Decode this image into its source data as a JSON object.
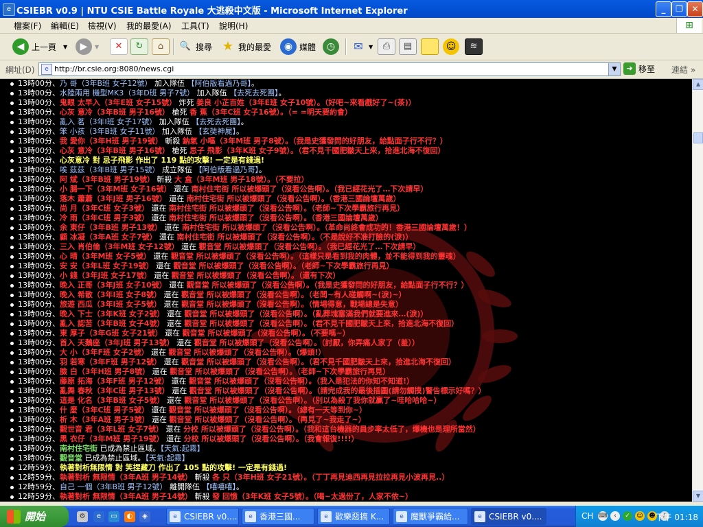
{
  "window": {
    "title": "CSIEBR v0.9 | NTU CSIE Battle Royale 大逃殺中文版 - Microsoft Internet Explorer",
    "minimize": "_",
    "restore": "❐",
    "close": "✕"
  },
  "menu": [
    "檔案(F)",
    "編輯(E)",
    "檢視(V)",
    "我的最愛(A)",
    "工具(T)",
    "說明(H)"
  ],
  "toolbar": {
    "back_label": "上一頁",
    "search_label": "搜尋",
    "favorites_label": "我的最愛",
    "media_label": "媒體"
  },
  "address": {
    "label": "網址(D)",
    "url": "http://br.csie.org:8080/news.cgi",
    "go_label": "移至",
    "links_label": "連結",
    "more": "»"
  },
  "news": [
    [
      {
        "t": "13時00分、",
        "c": "t"
      },
      {
        "t": "乃 哥（3年B班 女子12號）",
        "c": "b"
      },
      {
        "t": " 加入隊伍 ",
        "c": "w"
      },
      {
        "t": "【阿伯版看過乃哥】",
        "c": "b"
      },
      {
        "t": "。",
        "c": "w"
      }
    ],
    [
      {
        "t": "13時00分、",
        "c": "t"
      },
      {
        "t": "水陸兩用 機型MK3（3年D班 男子7號）",
        "c": "b"
      },
      {
        "t": " 加入隊伍 ",
        "c": "w"
      },
      {
        "t": "【去死去死團】",
        "c": "b"
      },
      {
        "t": "。",
        "c": "w"
      }
    ],
    [
      {
        "t": "13時00分、",
        "c": "t"
      },
      {
        "t": "鬼眼 太早入（3年E班 女子15號）",
        "c": "r"
      },
      {
        "t": " 炸死 ",
        "c": "w"
      },
      {
        "t": "姜良 小芷百姓（3年E班 女子10號）",
        "c": "r"
      },
      {
        "t": "。（好吧~來看戲好了~(茶)）",
        "c": "r"
      }
    ],
    [
      {
        "t": "13時00分、",
        "c": "t"
      },
      {
        "t": "心灰 意冷（3年B班 男子16號）",
        "c": "r"
      },
      {
        "t": " 槍死 ",
        "c": "w"
      },
      {
        "t": "香 蕉（3年C班 女子16號）",
        "c": "r"
      },
      {
        "t": "。（= =明天要約會）",
        "c": "r"
      }
    ],
    [
      {
        "t": "13時00分、",
        "c": "t"
      },
      {
        "t": "亂入 茗（3年I班 女子17號）",
        "c": "b"
      },
      {
        "t": " 加入隊伍 ",
        "c": "w"
      },
      {
        "t": "【去死去死團】",
        "c": "b"
      },
      {
        "t": "。",
        "c": "w"
      }
    ],
    [
      {
        "t": "13時00分、",
        "c": "t"
      },
      {
        "t": "笨 小孩（3年B班 女子11號）",
        "c": "b"
      },
      {
        "t": " 加入隊伍 ",
        "c": "w"
      },
      {
        "t": "【玄奘神屍】",
        "c": "b"
      },
      {
        "t": "。",
        "c": "w"
      }
    ],
    [
      {
        "t": "13時00分、",
        "c": "t"
      },
      {
        "t": "我 愛你（3年H班 男子19號）",
        "c": "r"
      },
      {
        "t": " 斬殺 ",
        "c": "w"
      },
      {
        "t": "鈉氣 小嘔（3年M班 男子8號）",
        "c": "r"
      },
      {
        "t": "。（我是史獲發問的好朋友，給點面子行不行？）",
        "c": "r"
      }
    ],
    [
      {
        "t": "13時00分、",
        "c": "t"
      },
      {
        "t": "心灰 意冷（3年B班 男子16號）",
        "c": "r"
      },
      {
        "t": " 槍死 ",
        "c": "w"
      },
      {
        "t": "忌子 飛影（3年K班 女子9號）",
        "c": "r"
      },
      {
        "t": "。（君不見千國肥皺天上來，拾進北海不復回）",
        "c": "r"
      }
    ],
    [
      {
        "t": "13時00分、",
        "c": "t"
      },
      {
        "t": "心灰意冷 對 忌子飛影 作出了 ",
        "c": "y"
      },
      {
        "t": "119",
        "c": "y"
      },
      {
        "t": " 點的攻擊! 一定是有錢過!",
        "c": "y"
      }
    ],
    [
      {
        "t": "13時00分、",
        "c": "t"
      },
      {
        "t": "唉 茲茲（3年B班 男子15號）",
        "c": "b"
      },
      {
        "t": " 成立隊伍 ",
        "c": "w"
      },
      {
        "t": "【阿伯版看過乃哥】",
        "c": "b"
      },
      {
        "t": "。",
        "c": "w"
      }
    ],
    [
      {
        "t": "13時00分、",
        "c": "t"
      },
      {
        "t": "阿 斌（3年B班 男子19號）",
        "c": "r"
      },
      {
        "t": " 斬殺 ",
        "c": "w"
      },
      {
        "t": "大 盒（3年M班 男子18號）",
        "c": "r"
      },
      {
        "t": "。（不要拉）",
        "c": "r"
      }
    ],
    [
      {
        "t": "13時00分、",
        "c": "t"
      },
      {
        "t": "小 腸一下（3年M班 女子16號）",
        "c": "r"
      },
      {
        "t": " 還在 ",
        "c": "w"
      },
      {
        "t": "南村住宅街",
        "c": "r"
      },
      {
        "t": " 所以被爆頭了（沒看公告啊）。（我已經花光了…下次請早）",
        "c": "r"
      }
    ],
    [
      {
        "t": "13時00分、",
        "c": "t"
      },
      {
        "t": "落木 蕭蕭（3年J班 男子16號）",
        "c": "r"
      },
      {
        "t": " 還在 ",
        "c": "w"
      },
      {
        "t": "南村住宅街",
        "c": "r"
      },
      {
        "t": " 所以被爆頭了（沒看公告啊）。（香港三國論壇萬歲）",
        "c": "r"
      }
    ],
    [
      {
        "t": "13時00分、",
        "c": "t"
      },
      {
        "t": "尚 月（3年C班 女子3號）",
        "c": "r"
      },
      {
        "t": " 還在 ",
        "c": "w"
      },
      {
        "t": "南村住宅街",
        "c": "r"
      },
      {
        "t": " 所以被爆頭了（沒看公告啊）。（老師~下次學霸旅行再見）",
        "c": "r"
      }
    ],
    [
      {
        "t": "13時00分、",
        "c": "t"
      },
      {
        "t": "冷 雨（3年C班 男子3號）",
        "c": "r"
      },
      {
        "t": " 還在 ",
        "c": "w"
      },
      {
        "t": "南村住宅街",
        "c": "r"
      },
      {
        "t": " 所以被爆頭了（沒看公告啊）。（香港三國論壇萬歲）",
        "c": "r"
      }
    ],
    [
      {
        "t": "13時00分、",
        "c": "t"
      },
      {
        "t": "余 東仔（3年B班 男子13號）",
        "c": "r"
      },
      {
        "t": " 還在 ",
        "c": "w"
      },
      {
        "t": "南村住宅街",
        "c": "r"
      },
      {
        "t": " 所以被爆頭了（沒看公告啊）。（革命尚終會成功的！香港三國論壇萬歲！）",
        "c": "r"
      }
    ],
    [
      {
        "t": "13時00分、",
        "c": "t"
      },
      {
        "t": "顧 冰凝（3年A班 女子7號）",
        "c": "r"
      },
      {
        "t": " 還在 ",
        "c": "w"
      },
      {
        "t": "南村住宅街",
        "c": "r"
      },
      {
        "t": " 所以被爆頭了（沒看公告啊）。（不是說好不准打臉的(淚)）",
        "c": "r"
      }
    ],
    [
      {
        "t": "13時00分、",
        "c": "t"
      },
      {
        "t": "三入 肖伯倫（3年M班 女子12號）",
        "c": "r"
      },
      {
        "t": " 還在 ",
        "c": "w"
      },
      {
        "t": "觀音堂",
        "c": "r"
      },
      {
        "t": " 所以被爆頭了（沒看公告啊）。（我已經花光了…下次請早）",
        "c": "r"
      }
    ],
    [
      {
        "t": "13時00分、",
        "c": "t"
      },
      {
        "t": "心 晴（3年M班 女子5號）",
        "c": "r"
      },
      {
        "t": " 還在 ",
        "c": "w"
      },
      {
        "t": "觀音堂",
        "c": "r"
      },
      {
        "t": " 所以被爆頭了（沒看公告啊）。（這樣只是看到我的肉體，並不能得到我的靈魂）",
        "c": "r"
      }
    ],
    [
      {
        "t": "13時00分、",
        "c": "t"
      },
      {
        "t": "安 安（3年L班 女子19號）",
        "c": "r"
      },
      {
        "t": " 還在 ",
        "c": "w"
      },
      {
        "t": "觀音堂",
        "c": "r"
      },
      {
        "t": " 所以被爆頭了（沒看公告啊）。（老師~下次學霸旅行再見）",
        "c": "r"
      }
    ],
    [
      {
        "t": "13時00分、",
        "c": "t"
      },
      {
        "t": "小 錢（3年J班 女子17號）",
        "c": "r"
      },
      {
        "t": " 還在 ",
        "c": "w"
      },
      {
        "t": "觀音堂",
        "c": "r"
      },
      {
        "t": " 所以被爆頭了（沒看公告啊）。（還有下次）",
        "c": "r"
      }
    ],
    [
      {
        "t": "13時00分、",
        "c": "t"
      },
      {
        "t": "晚入 正哥（3年J班 女子10號）",
        "c": "r"
      },
      {
        "t": " 還在 ",
        "c": "w"
      },
      {
        "t": "觀音堂",
        "c": "r"
      },
      {
        "t": " 所以被爆頭了（沒看公告啊）。（我是史獲發問的好朋友，給點面子行不行？）",
        "c": "r"
      }
    ],
    [
      {
        "t": "13時00分、",
        "c": "t"
      },
      {
        "t": "晚入 希散（3年I班 女子8號）",
        "c": "r"
      },
      {
        "t": " 還在 ",
        "c": "w"
      },
      {
        "t": "觀音堂",
        "c": "r"
      },
      {
        "t": " 所以被爆頭了（沒看公告啊）。（老闆~有人碰觸啊~(淚)~）",
        "c": "r"
      }
    ],
    [
      {
        "t": "13時00分、",
        "c": "t"
      },
      {
        "t": "旅遊 西瓜（3年I班 女子5號）",
        "c": "r"
      },
      {
        "t": " 還在 ",
        "c": "w"
      },
      {
        "t": "觀音堂",
        "c": "r"
      },
      {
        "t": " 所以被爆頭了（沒看公告啊）。（情場得意，戰場總是失意）",
        "c": "r"
      }
    ],
    [
      {
        "t": "13時00分、",
        "c": "t"
      },
      {
        "t": "晚入 下士（3年K班 女子2號）",
        "c": "r"
      },
      {
        "t": " 還在 ",
        "c": "w"
      },
      {
        "t": "觀音堂",
        "c": "r"
      },
      {
        "t": " 所以被爆頭了（沒看公告啊）。（亂葬塊塞滿我們就要進來…(淚)）",
        "c": "r"
      }
    ],
    [
      {
        "t": "13時00分、",
        "c": "t"
      },
      {
        "t": "亂入 認苦（3年B班 女子4號）",
        "c": "r"
      },
      {
        "t": " 還在 ",
        "c": "w"
      },
      {
        "t": "觀音堂",
        "c": "r"
      },
      {
        "t": " 所以被爆頭了（沒看公告啊）。（君不見千國肥皺天上來，拾進北海不復回）",
        "c": "r"
      }
    ],
    [
      {
        "t": "13時00分、",
        "c": "t"
      },
      {
        "t": "東 厚子（3年G班 女子21號）",
        "c": "r"
      },
      {
        "t": " 還在 ",
        "c": "w"
      },
      {
        "t": "觀音堂",
        "c": "r"
      },
      {
        "t": " 所以被爆頭了（沒看公告啊）。（不要嗎~）",
        "c": "r"
      }
    ],
    [
      {
        "t": "13時00分、",
        "c": "t"
      },
      {
        "t": "首入 天鵝座（3年J班 男子13號）",
        "c": "r"
      },
      {
        "t": " 還在 ",
        "c": "w"
      },
      {
        "t": "觀音堂",
        "c": "r"
      },
      {
        "t": " 所以被爆頭了（沒看公告啊）。（討厭，你弄痛人家了（羞））",
        "c": "r"
      }
    ],
    [
      {
        "t": "13時00分、",
        "c": "t"
      },
      {
        "t": "大 小（3年F班 女子2號）",
        "c": "r"
      },
      {
        "t": " 還在 ",
        "c": "w"
      },
      {
        "t": "觀音堂",
        "c": "r"
      },
      {
        "t": " 所以被爆頭了（沒看公告啊）。（爆頭!）",
        "c": "r"
      }
    ],
    [
      {
        "t": "13時00分、",
        "c": "t"
      },
      {
        "t": "羽 若寒（3年F班 男子12號）",
        "c": "r"
      },
      {
        "t": " 還在 ",
        "c": "w"
      },
      {
        "t": "觀音堂",
        "c": "r"
      },
      {
        "t": " 所以被爆頭了（沒看公告啊）。（君不見千國肥皺天上來，拾進北海不復回）",
        "c": "r"
      }
    ],
    [
      {
        "t": "13時00分、",
        "c": "t"
      },
      {
        "t": "臉 白（3年H班 男子8號）",
        "c": "r"
      },
      {
        "t": " 還在 ",
        "c": "w"
      },
      {
        "t": "觀音堂",
        "c": "r"
      },
      {
        "t": " 所以被爆頭了（沒看公告啊）。（老師~下次學霸旅行再見）",
        "c": "r"
      }
    ],
    [
      {
        "t": "13時00分、",
        "c": "t"
      },
      {
        "t": "藤原 拓海（3年F班 男子12號）",
        "c": "r"
      },
      {
        "t": " 還在 ",
        "c": "w"
      },
      {
        "t": "觀音堂",
        "c": "r"
      },
      {
        "t": " 所以被爆頭了（沒看公告啊）。（我入是犯法的你知不知道!）",
        "c": "r"
      }
    ],
    [
      {
        "t": "13時00分、",
        "c": "t"
      },
      {
        "t": "亂舞 春秋（3年C班 男子13號）",
        "c": "r"
      },
      {
        "t": " 還在 ",
        "c": "w"
      },
      {
        "t": "觀音堂",
        "c": "r"
      },
      {
        "t": " 所以被爆頭了（沒看公告啊）。（請完成我的最後插圖(請勿觸摸)警告標示好嗎？）",
        "c": "r"
      }
    ],
    [
      {
        "t": "13時00分、",
        "c": "t"
      },
      {
        "t": "這是 化名（3年B班 女子5號）",
        "c": "r"
      },
      {
        "t": " 還在 ",
        "c": "w"
      },
      {
        "t": "觀音堂",
        "c": "r"
      },
      {
        "t": " 所以被爆頭了（沒看公告啊）。（別以為殺了我你就贏了~哇哈哈哈~）",
        "c": "r"
      }
    ],
    [
      {
        "t": "13時00分、",
        "c": "t"
      },
      {
        "t": "什 麼（3年C班 男子5號）",
        "c": "r"
      },
      {
        "t": " 還在 ",
        "c": "w"
      },
      {
        "t": "觀音堂",
        "c": "r"
      },
      {
        "t": " 所以被爆頭了（沒看公告啊）。（總有一天等到你~）",
        "c": "r"
      }
    ],
    [
      {
        "t": "13時00分、",
        "c": "t"
      },
      {
        "t": "析 木（3年A班 男子3號）",
        "c": "r"
      },
      {
        "t": " 還在 ",
        "c": "w"
      },
      {
        "t": "觀音堂",
        "c": "r"
      },
      {
        "t": " 所以被爆頭了（沒看公告啊）。（再見了~我走了~）",
        "c": "r"
      }
    ],
    [
      {
        "t": "13時00分、",
        "c": "t"
      },
      {
        "t": "觀世音 君（3年L班 女子7號）",
        "c": "r"
      },
      {
        "t": " 還在 ",
        "c": "w"
      },
      {
        "t": "分校",
        "c": "r"
      },
      {
        "t": " 所以被爆頭了（沒看公告啊）。（我和這台機器的員步率太低了，爆機也是理所當然）",
        "c": "r"
      }
    ],
    [
      {
        "t": "13時00分、",
        "c": "t"
      },
      {
        "t": "黑 衣仔（3年M班 男子19號）",
        "c": "r"
      },
      {
        "t": " 還在 ",
        "c": "w"
      },
      {
        "t": "分校",
        "c": "r"
      },
      {
        "t": " 所以被爆頭了（沒看公告啊）。（我會報復!!!!）",
        "c": "r"
      }
    ],
    [
      {
        "t": "13時00分、",
        "c": "t"
      },
      {
        "t": "南村住宅街",
        "c": "g"
      },
      {
        "t": " 已成為禁止區域。",
        "c": "w"
      },
      {
        "t": "【天氣:起霧】",
        "c": "b"
      }
    ],
    [
      {
        "t": "13時00分、",
        "c": "t"
      },
      {
        "t": "觀音堂",
        "c": "g"
      },
      {
        "t": " 已成為禁止區域。",
        "c": "w"
      },
      {
        "t": "【天氣:起霧】",
        "c": "b"
      }
    ],
    [
      {
        "t": "12時59分、",
        "c": "t"
      },
      {
        "t": "執著對析無限情 對 笑捏藏刀 作出了 ",
        "c": "y"
      },
      {
        "t": "105",
        "c": "y"
      },
      {
        "t": " 點的攻擊! 一定是有錢過!",
        "c": "y"
      }
    ],
    [
      {
        "t": "12時59分、",
        "c": "t"
      },
      {
        "t": "執著對析 無限情（3年A班 男子14號）",
        "c": "r"
      },
      {
        "t": " 斬殺 ",
        "c": "w"
      },
      {
        "t": "各 只（3年H班 女子21號）",
        "c": "r"
      },
      {
        "t": "。（丁丁再見迪西再見拉拉再見小波再見..）",
        "c": "r"
      }
    ],
    [
      {
        "t": "12時59分、",
        "c": "t"
      },
      {
        "t": "自己 一個（3年B班 男子12號）",
        "c": "b"
      },
      {
        "t": " 離開隊伍 ",
        "c": "w"
      },
      {
        "t": "【嘻嘻嘻】",
        "c": "b"
      },
      {
        "t": "。",
        "c": "w"
      }
    ],
    [
      {
        "t": "12時59分、",
        "c": "t"
      },
      {
        "t": "執著對析 無限情（3年A班 男子14號）",
        "c": "r"
      },
      {
        "t": " 斬殺 ",
        "c": "w"
      },
      {
        "t": "發 回憶（3年K班 女子5號）",
        "c": "r"
      },
      {
        "t": "。（喝~太過份了，人家不依~）",
        "c": "r"
      }
    ]
  ],
  "taskbar": {
    "start_label": "開始",
    "tasks": [
      "CSIEBR v0....",
      "香港三國...",
      "歡樂惡搞 K...",
      "魔獸爭霸給...",
      "CSIEBR v0...."
    ],
    "lang": "CH",
    "clock": "下午 01:18"
  },
  "colors": {
    "accent": "#0453d6",
    "kill_text": "#ff3333",
    "team_text": "#9fc3ff",
    "zone_text": "#7fe06a"
  }
}
